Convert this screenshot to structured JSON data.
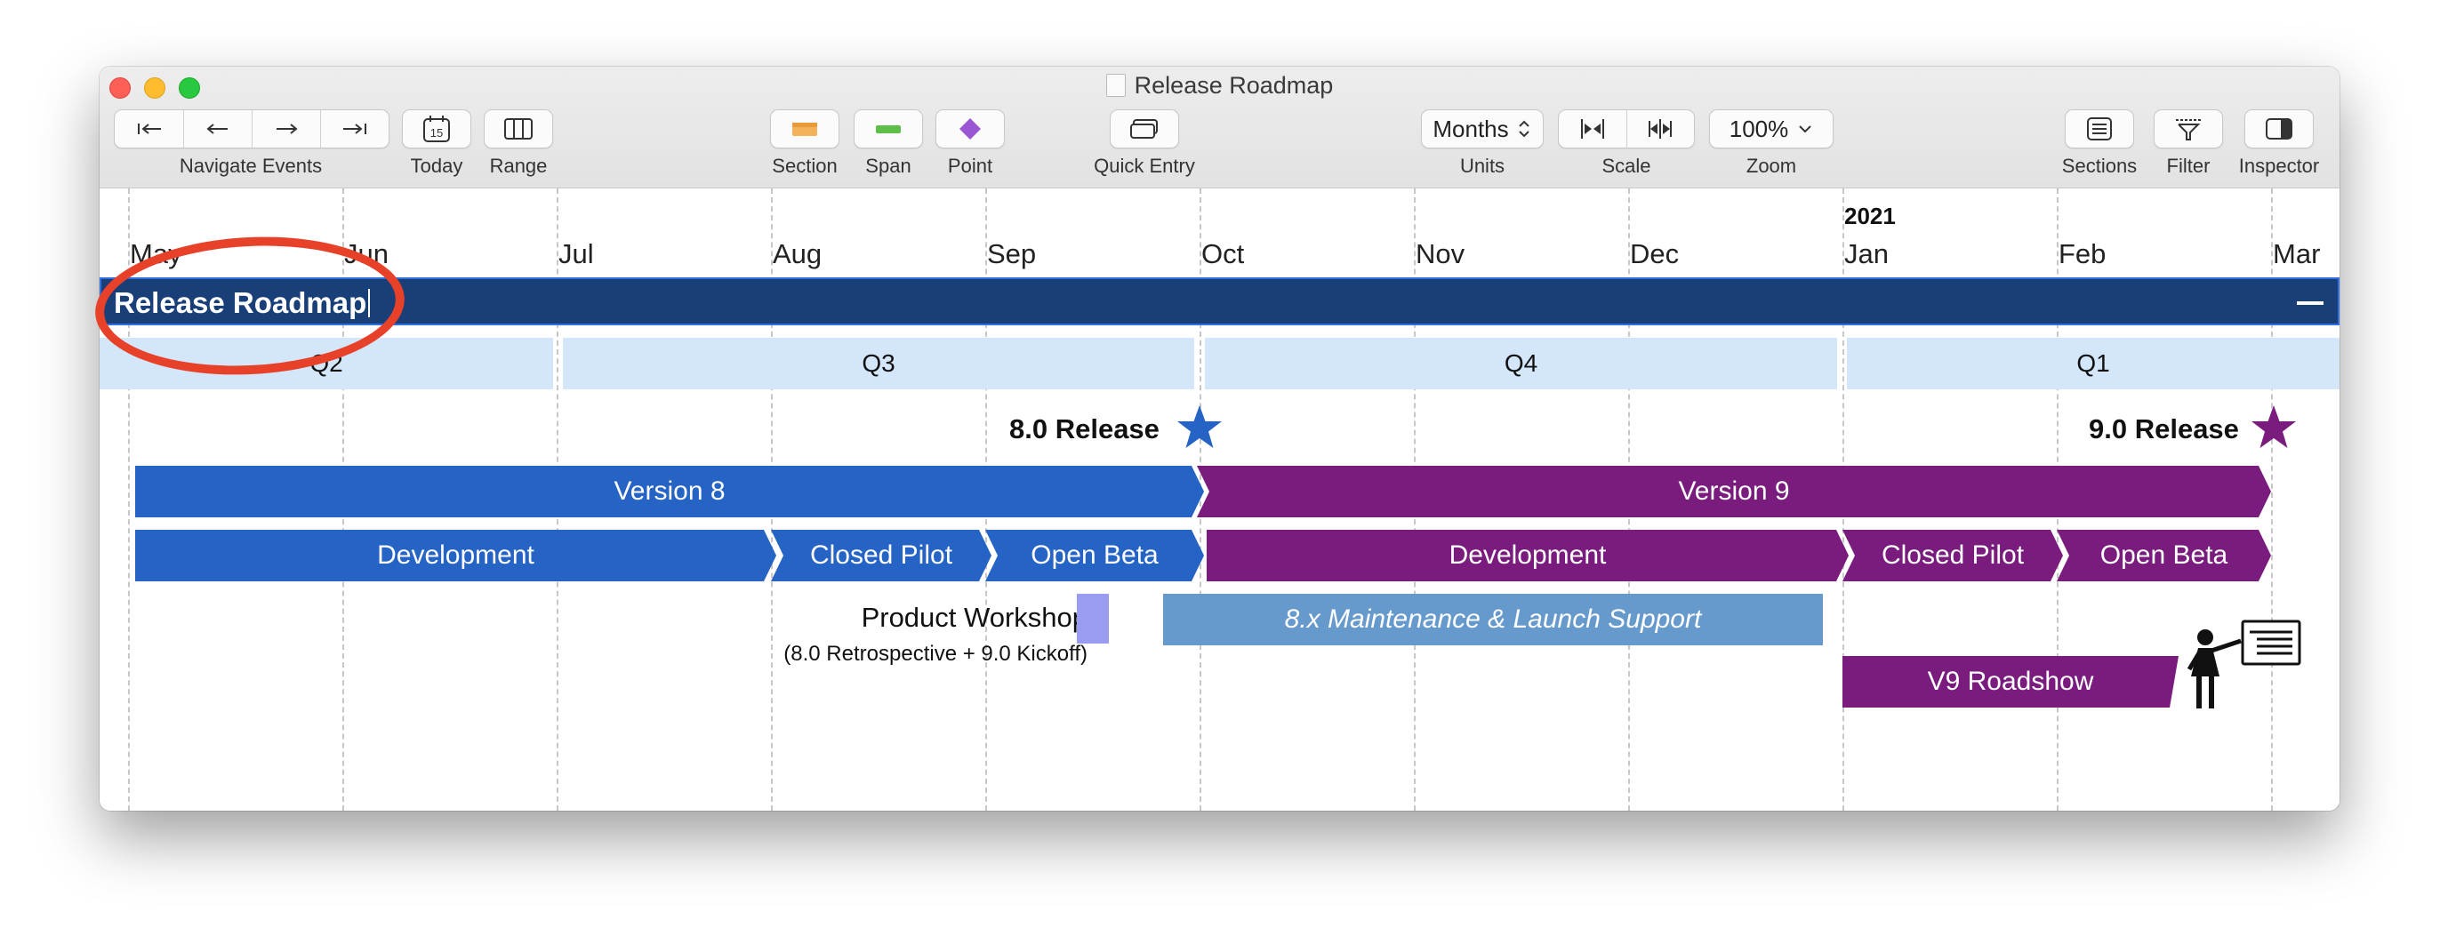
{
  "window": {
    "title": "Release Roadmap"
  },
  "toolbar": {
    "navigate_label": "Navigate Events",
    "today_label": "Today",
    "today_day": "15",
    "range_label": "Range",
    "section_label": "Section",
    "span_label": "Span",
    "point_label": "Point",
    "quick_entry_label": "Quick Entry",
    "units_value": "Months",
    "units_label": "Units",
    "scale_label": "Scale",
    "zoom_value": "100%",
    "zoom_label": "Zoom",
    "sections_label": "Sections",
    "filter_label": "Filter",
    "inspector_label": "Inspector"
  },
  "timeline": {
    "year_label": "2021",
    "months": [
      "May",
      "Jun",
      "Jul",
      "Aug",
      "Sep",
      "Oct",
      "Nov",
      "Dec",
      "Jan",
      "Feb",
      "Mar"
    ],
    "banner_title": "Release Roadmap",
    "quarters": [
      "Q2",
      "Q3",
      "Q4",
      "Q1"
    ],
    "milestones": [
      {
        "label": "8.0 Release",
        "color": "#2563c4"
      },
      {
        "label": "9.0 Release",
        "color": "#7a1c7e"
      }
    ],
    "versions": [
      {
        "label": "Version 8",
        "color": "#2563c4"
      },
      {
        "label": "Version 9",
        "color": "#7a1c7e"
      }
    ],
    "phases_v8": [
      "Development",
      "Closed Pilot",
      "Open Beta"
    ],
    "phases_v9": [
      "Development",
      "Closed Pilot",
      "Open Beta"
    ],
    "workshop_title": "Product Workshop",
    "workshop_subtitle": "(8.0 Retrospective + 9.0 Kickoff)",
    "maintenance_label": "8.x Maintenance & Launch Support",
    "roadshow_label": "V9 Roadshow"
  },
  "colors": {
    "version8": "#2563c4",
    "version9": "#7a1c7e",
    "banner": "#193f78",
    "quarter": "#d3e6fa",
    "maintenance": "#6699cc",
    "workshop": "#9a9cf2",
    "highlight": "#e8412a"
  },
  "icons": [
    "navigate-first-icon",
    "navigate-previous-icon",
    "navigate-next-icon",
    "navigate-last-icon",
    "calendar-icon",
    "range-icon",
    "section-icon",
    "span-icon",
    "point-icon",
    "quick-entry-icon",
    "scale-shrink-icon",
    "scale-expand-icon",
    "chevron-down-icon",
    "sections-icon",
    "filter-icon",
    "inspector-icon",
    "star-icon",
    "presenter-icon",
    "double-chevron-left-icon",
    "chevron-left-icon",
    "chevron-right-icon",
    "double-chevron-right-icon"
  ]
}
